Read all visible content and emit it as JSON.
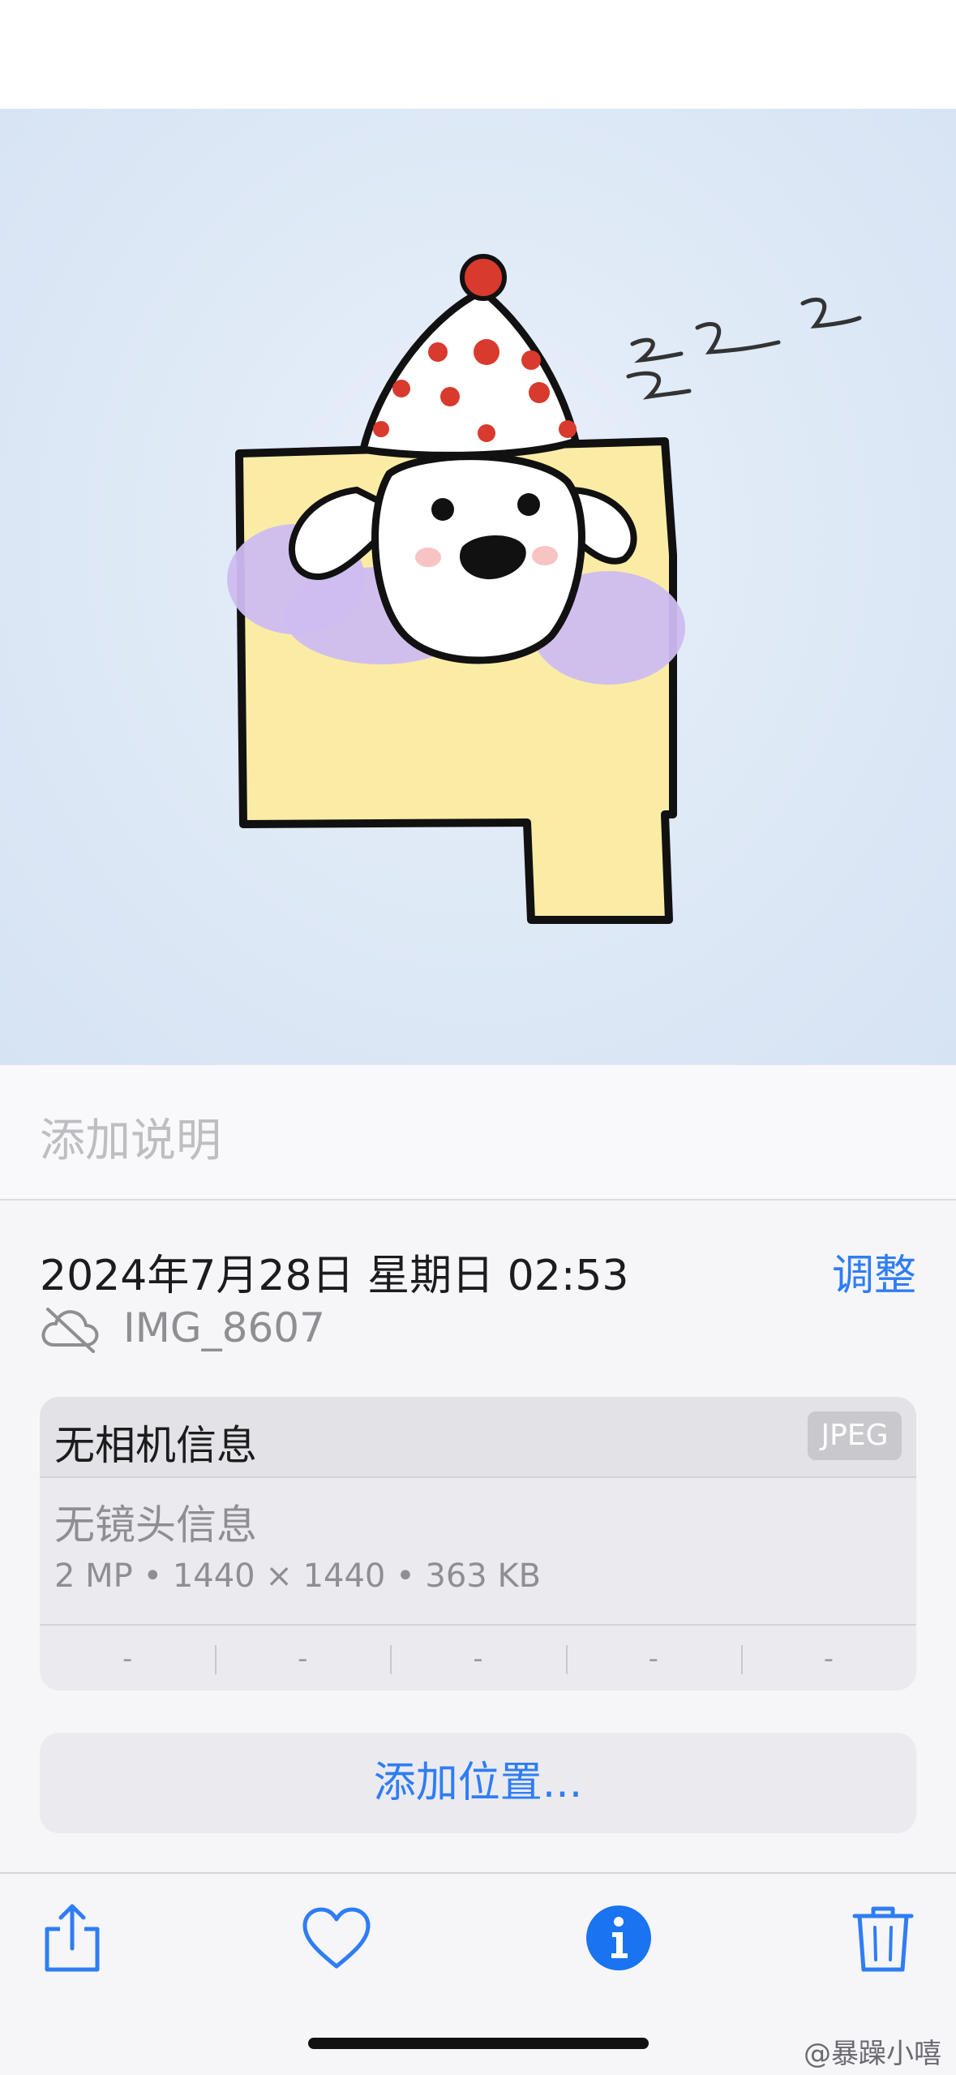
{
  "caption": {
    "placeholder": "添加说明"
  },
  "info": {
    "date": "2024年7月28日 星期日 02:53",
    "adjust_label": "调整",
    "filename": "IMG_8607",
    "camera": "无相机信息",
    "format_badge": "JPEG",
    "lens": "无镜头信息",
    "specs": "2 MP • 1440 × 1440 • 363 KB",
    "exif": [
      "-",
      "-",
      "-",
      "-",
      "-"
    ],
    "location_label": "添加位置..."
  },
  "toolbar": {
    "share_icon": "share-icon",
    "favorite_icon": "heart-icon",
    "info_icon": "info-icon",
    "delete_icon": "trash-icon"
  },
  "colors": {
    "accent": "#2f7df6",
    "background": "#f6f6f8"
  },
  "watermark": "@暴躁小嘻"
}
